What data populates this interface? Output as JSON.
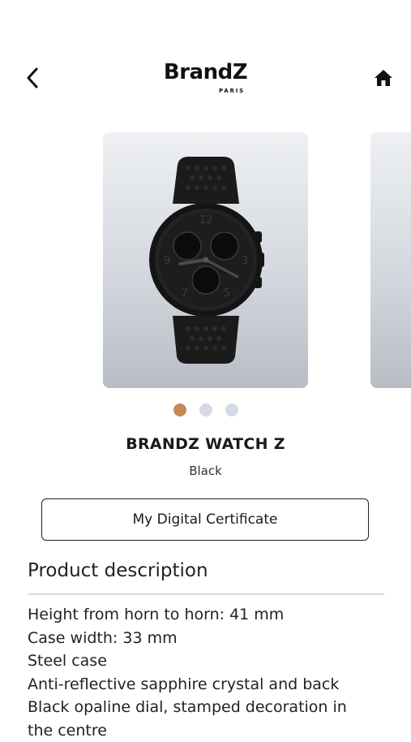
{
  "header": {
    "brand": "BrandZ",
    "brand_sub": "PARIS",
    "back_icon": "chevron-left-icon",
    "home_icon": "home-icon"
  },
  "carousel": {
    "slide_count": 3,
    "active_index": 0,
    "colors": {
      "active_dot": "#c48a57",
      "inactive_dot": "#d5d9e6"
    }
  },
  "product": {
    "name": "BRANDZ WATCH Z",
    "color": "Black"
  },
  "certificate_button": {
    "label": "My Digital Certificate"
  },
  "description": {
    "title": "Product description",
    "lines": [
      "Height from horn to horn: 41 mm",
      "Case width: 33 mm",
      "Steel case",
      "Anti-reflective sapphire crystal and back",
      "Black opaline dial, stamped decoration in",
      "the centre"
    ]
  }
}
